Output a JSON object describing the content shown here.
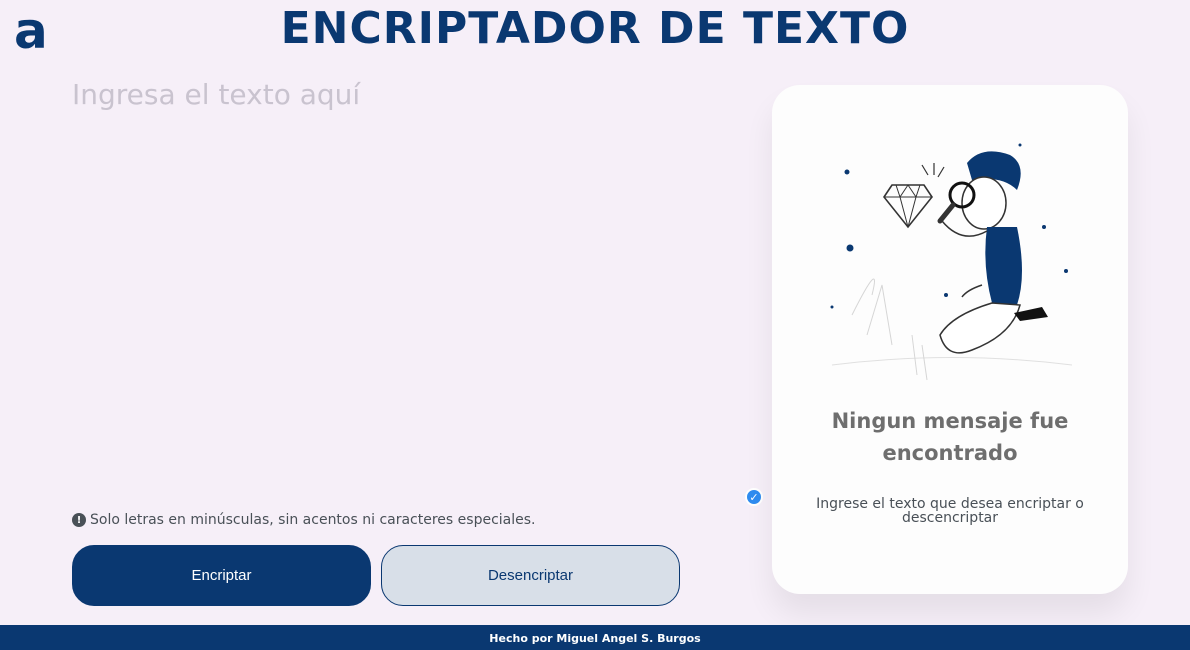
{
  "header": {
    "logo_text": "a",
    "title": "ENCRIPTADOR DE TEXTO"
  },
  "input": {
    "placeholder": "Ingresa el texto aquí",
    "value": ""
  },
  "notice": {
    "icon": "exclamation-circle-icon",
    "text": "Solo letras en minúsculas, sin acentos ni caracteres especiales."
  },
  "buttons": {
    "encrypt_label": "Encriptar",
    "decrypt_label": "Desencriptar"
  },
  "output_card": {
    "illustration": "person-with-magnifying-glass-and-diamond",
    "title": "Ningun mensaje fue encontrado",
    "text": "Ingrese el texto que desea encriptar o descencriptar"
  },
  "footer": {
    "text": "Hecho por Miguel Angel S. Burgos"
  },
  "colors": {
    "primary": "#0a3871",
    "background": "#f6eff8",
    "card": "#fdfdfd",
    "secondary_button": "#d8dfe8",
    "check_badge": "#2f8cf0"
  }
}
